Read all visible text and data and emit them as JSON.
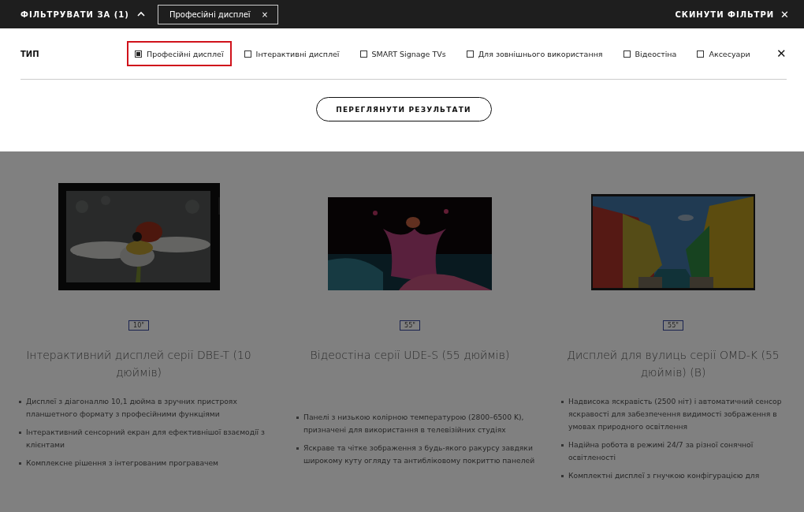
{
  "top_bar": {
    "filter_by": "ФІЛЬТРУВАТИ ЗА (1)",
    "expanded": true,
    "active_chips": [
      {
        "label": "Професійні дисплеї",
        "remove": "×"
      }
    ],
    "reset": "СКИНУТИ ФІЛЬТРИ",
    "reset_icon": "✕"
  },
  "filter_panel": {
    "group": "ТИП",
    "close": "✕",
    "options": [
      {
        "label": "Професійні дисплеї",
        "checked": true,
        "selected": true
      },
      {
        "label": "Інтерактивні дисплеї",
        "checked": false,
        "selected": false
      },
      {
        "label": "SMART Signage TVs",
        "checked": false,
        "selected": false
      },
      {
        "label": "Для зовнішнього використання",
        "checked": false,
        "selected": false
      },
      {
        "label": "Відеостіна",
        "checked": false,
        "selected": false
      },
      {
        "label": "Аксесуари",
        "checked": false,
        "selected": false
      }
    ],
    "view_results": "ПЕРЕГЛЯНУТИ РЕЗУЛЬТАТИ"
  },
  "products": [
    {
      "kind": "tablet",
      "size": "10\"",
      "title": "Інтерактивний дисплей серії DBE-T (10 дюймів)",
      "bullets": [
        "Дисплеї з діагоналлю 10,1 дюйма в зручних пристроях планшетного формату з професійними функціями",
        "Інтерактивний сенсорний екран для ефективнішої взаємодії з клієнтами",
        "Комплексне рішення з інтегрованим програвачем"
      ]
    },
    {
      "kind": "splash",
      "size": "55\"",
      "title": "Відеостіна серії UDE-S (55 дюймів)",
      "bullets": [
        "Панелі з низькою колірною температурою (2800–6500 K), призначені для використання в телевізійних студіях",
        "Яскраве та чітке зображення з будь-якого ракурсу завдяки широкому куту огляду та антибліковому покриттю панелей"
      ]
    },
    {
      "kind": "street",
      "size": "55\"",
      "title": "Дисплей для вулиць серії OMD-K (55 дюймів) (B)",
      "bullets": [
        "Надвисока яскравість (2500 ніт) і автоматичний сенсор яскравості для забезпечення видимості зображення в умовах природного освітлення",
        "Надійна робота в режимі 24/7 за різної сонячної освітленості",
        "Комплектні дисплеї з гнучкою конфігурацією для"
      ]
    }
  ]
}
